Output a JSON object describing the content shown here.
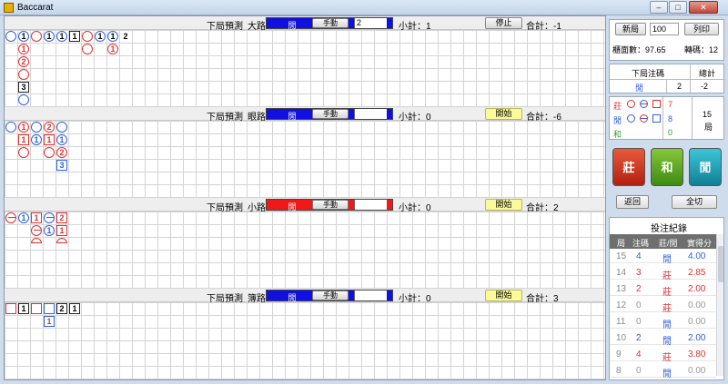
{
  "window": {
    "title": "Baccarat"
  },
  "roads": [
    {
      "pred_label": "下局預測",
      "name": "大路",
      "pred_value": "閒",
      "pred_color": "blue",
      "mode": "手動",
      "input": "2",
      "subtotal": "小計：1",
      "action": "停止",
      "action_style": "gray",
      "total": "合計：-1"
    },
    {
      "pred_label": "下局預測",
      "name": "眼路",
      "pred_value": "閒",
      "pred_color": "blue",
      "mode": "手動",
      "input": "",
      "subtotal": "小計：0",
      "action": "開始",
      "action_style": "yellow",
      "total": "合計：-6"
    },
    {
      "pred_label": "下局預測",
      "name": "小路",
      "pred_value": "閒",
      "pred_color": "red",
      "mode": "手動",
      "input": "",
      "subtotal": "小計：0",
      "action": "開始",
      "action_style": "yellow",
      "total": "合計：2"
    },
    {
      "pred_label": "下局預測",
      "name": "簿路",
      "pred_value": "閒",
      "pred_color": "blue",
      "mode": "手動",
      "input": "",
      "subtotal": "小計：0",
      "action": "開始",
      "action_style": "yellow",
      "total": "合計：3"
    }
  ],
  "marks": {
    "big_road": [
      "1",
      "1",
      "1",
      "1",
      "1",
      "1",
      "2",
      "1",
      "1",
      "2",
      "3"
    ],
    "eye_road": [
      "1",
      "2",
      "1",
      "1",
      "1",
      "1",
      "2",
      "3"
    ],
    "small_road": [
      "1",
      "1",
      "2",
      "1",
      "1"
    ],
    "bead_road": [
      "1",
      "2",
      "1",
      "1"
    ]
  },
  "panel": {
    "new_game_btn": "新局",
    "new_game_value": "100",
    "print_btn": "列印",
    "chips_label": "櫃面數：97.65",
    "turn_label": "轉碼：12",
    "next_bet_header": "下局注碼",
    "total_header": "總計",
    "next_side": "閒",
    "next_amount": "2",
    "next_total": "-2",
    "stats": [
      {
        "label": "莊",
        "value": "7"
      },
      {
        "label": "閒",
        "value": "8"
      },
      {
        "label": "和",
        "value": "0"
      }
    ],
    "round_count": "15",
    "round_unit": "局",
    "banker_btn": "莊",
    "tie_btn": "和",
    "player_btn": "閒",
    "undo_btn": "返回",
    "switch_btn": "全切",
    "history_title": "投注紀錄",
    "history_headers": [
      "局",
      "注碼",
      "莊/閒",
      "實得分"
    ],
    "history": [
      {
        "round": "15",
        "bet": "4",
        "side": "閒",
        "score": "4.00"
      },
      {
        "round": "14",
        "bet": "3",
        "side": "莊",
        "score": "2.85"
      },
      {
        "round": "13",
        "bet": "2",
        "side": "莊",
        "score": "2.00"
      },
      {
        "round": "12",
        "bet": "0",
        "side": "莊",
        "score": "0.00"
      },
      {
        "round": "11",
        "bet": "0",
        "side": "閒",
        "score": "0.00"
      },
      {
        "round": "10",
        "bet": "2",
        "side": "閒",
        "score": "2.00"
      },
      {
        "round": "9",
        "bet": "4",
        "side": "莊",
        "score": "3.80"
      },
      {
        "round": "8",
        "bet": "0",
        "side": "閒",
        "score": "0.00"
      }
    ]
  },
  "colors": {
    "banker": "#e03030",
    "player": "#3060e0",
    "tie": "#28a028",
    "accent_blue": "#1010e0",
    "accent_red": "#f01818"
  }
}
